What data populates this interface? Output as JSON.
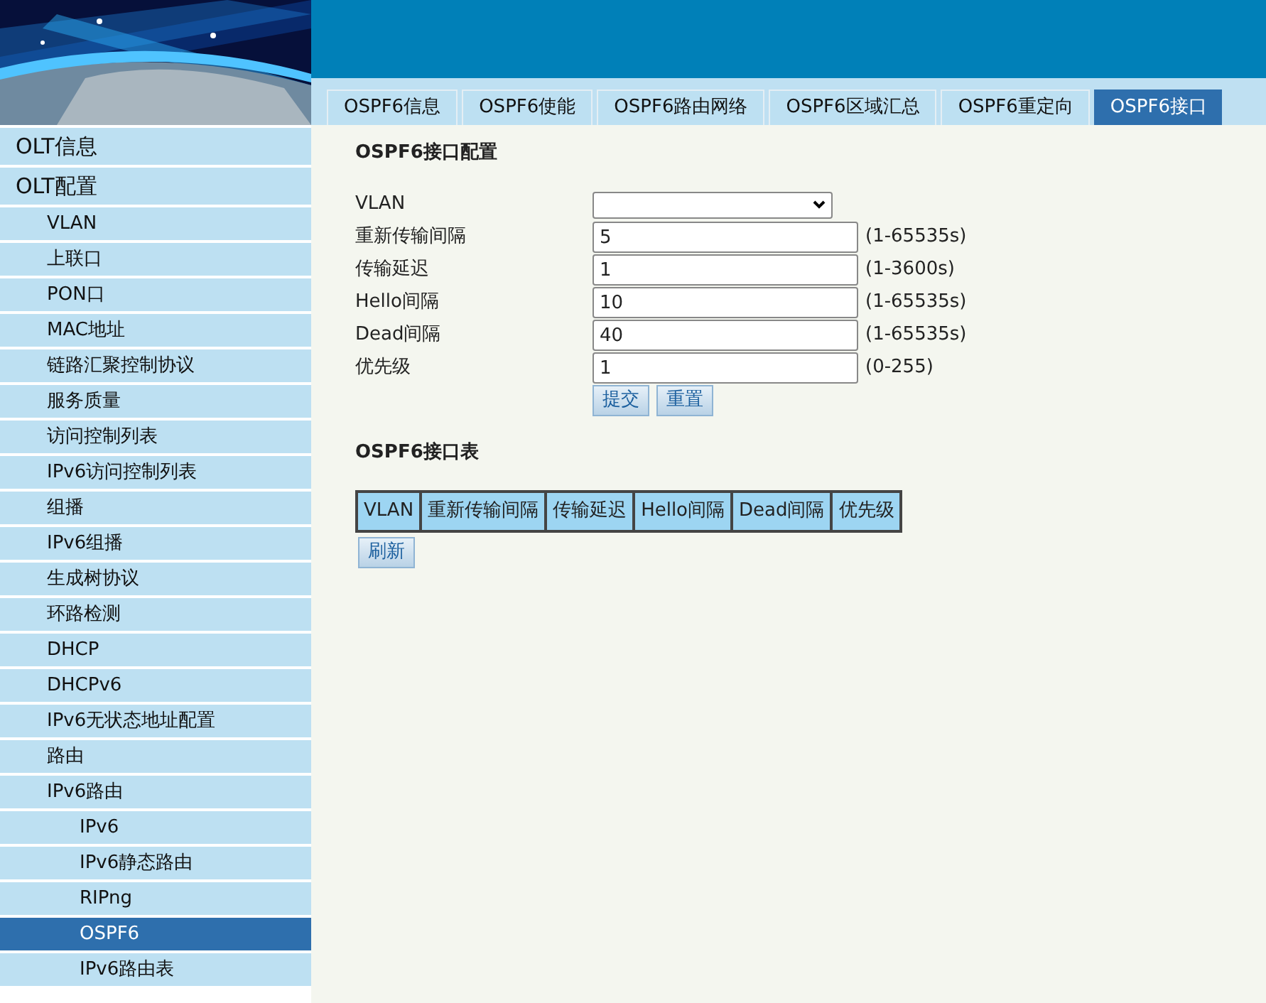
{
  "sidebar": {
    "items": [
      {
        "label": "OLT信息",
        "selected": false
      },
      {
        "label": "OLT配置",
        "selected": false,
        "children": [
          {
            "label": "VLAN",
            "selected": false
          },
          {
            "label": "上联口",
            "selected": false
          },
          {
            "label": "PON口",
            "selected": false
          },
          {
            "label": "MAC地址",
            "selected": false
          },
          {
            "label": "链路汇聚控制协议",
            "selected": false
          },
          {
            "label": "服务质量",
            "selected": false
          },
          {
            "label": "访问控制列表",
            "selected": false
          },
          {
            "label": "IPv6访问控制列表",
            "selected": false
          },
          {
            "label": "组播",
            "selected": false
          },
          {
            "label": "IPv6组播",
            "selected": false
          },
          {
            "label": "生成树协议",
            "selected": false
          },
          {
            "label": "环路检测",
            "selected": false
          },
          {
            "label": "DHCP",
            "selected": false
          },
          {
            "label": "DHCPv6",
            "selected": false
          },
          {
            "label": "IPv6无状态地址配置",
            "selected": false
          },
          {
            "label": "路由",
            "selected": false
          },
          {
            "label": "IPv6路由",
            "selected": false,
            "children": [
              {
                "label": "IPv6",
                "selected": false
              },
              {
                "label": "IPv6静态路由",
                "selected": false
              },
              {
                "label": "RIPng",
                "selected": false
              },
              {
                "label": "OSPF6",
                "selected": true
              },
              {
                "label": "IPv6路由表",
                "selected": false
              }
            ]
          }
        ]
      }
    ]
  },
  "tabs": [
    {
      "label": "OSPF6信息",
      "selected": false
    },
    {
      "label": "OSPF6使能",
      "selected": false
    },
    {
      "label": "OSPF6路由网络",
      "selected": false
    },
    {
      "label": "OSPF6区域汇总",
      "selected": false
    },
    {
      "label": "OSPF6重定向",
      "selected": false
    },
    {
      "label": "OSPF6接口",
      "selected": true
    }
  ],
  "form": {
    "title": "OSPF6接口配置",
    "fields": [
      {
        "kind": "select",
        "label": "VLAN"
      },
      {
        "kind": "input",
        "label": "重新传输间隔",
        "value": "5",
        "hint": "(1-65535s)"
      },
      {
        "kind": "input",
        "label": "传输延迟",
        "value": "1",
        "hint": "(1-3600s)"
      },
      {
        "kind": "input",
        "label": "Hello间隔",
        "value": "10",
        "hint": "(1-65535s)"
      },
      {
        "kind": "input",
        "label": "Dead间隔",
        "value": "40",
        "hint": "(1-65535s)"
      },
      {
        "kind": "input",
        "label": "优先级",
        "value": "1",
        "hint": "(0-255)"
      }
    ],
    "buttons": [
      "提交",
      "重置"
    ]
  },
  "table": {
    "title": "OSPF6接口表",
    "columns": [
      "VLAN",
      "重新传输间隔",
      "传输延迟",
      "Hello间隔",
      "Dead间隔",
      "优先级"
    ],
    "buttons": [
      "刷新"
    ]
  }
}
